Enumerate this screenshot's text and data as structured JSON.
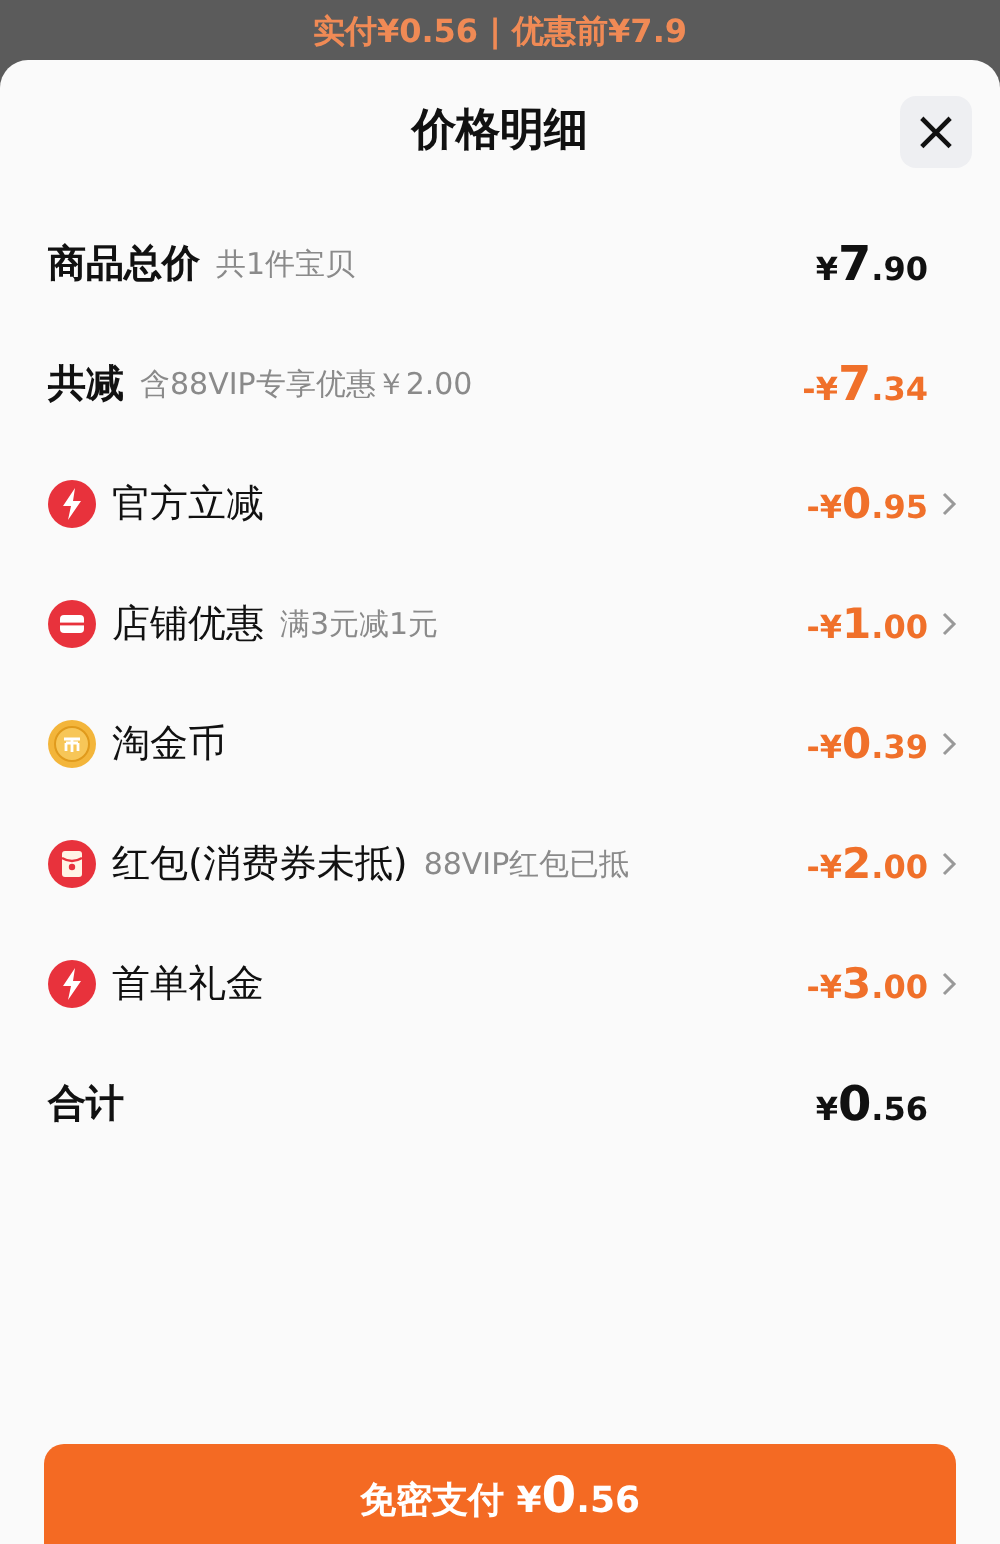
{
  "backdrop": {
    "text": "实付¥0.56 | 优惠前¥7.9"
  },
  "sheet": {
    "title": "价格明细",
    "close": "×"
  },
  "rows": [
    {
      "kind": "total",
      "label": "商品总价",
      "note": "共1件宝贝",
      "amount": "¥7.90"
    },
    {
      "kind": "discount_sum",
      "label": "共减",
      "note": "含88VIP专享优惠￥2.00",
      "amount": "-¥7.34"
    },
    {
      "kind": "bolt",
      "label": "官方立减",
      "amount": "-¥0.95"
    },
    {
      "kind": "store",
      "label": "店铺优惠",
      "note": "满3元减1元",
      "amount": "-¥1.00"
    },
    {
      "kind": "coin",
      "label": "淘金币",
      "amount": "-¥0.39"
    },
    {
      "kind": "packet",
      "label": "红包(消费券未抵)",
      "note": "88VIP红包已抵",
      "amount": "-¥2.00"
    },
    {
      "kind": "bolt",
      "label": "首单礼金",
      "amount": "-¥3.00"
    },
    {
      "kind": "sum",
      "label": "合计",
      "amount": "¥0.56"
    }
  ],
  "pay_button": {
    "label": "免密支付",
    "amount": "¥0.56"
  }
}
